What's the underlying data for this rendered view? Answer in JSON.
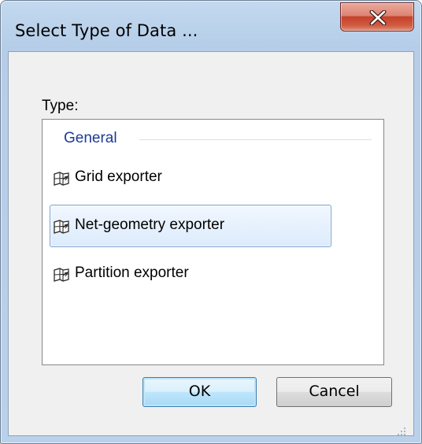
{
  "window": {
    "title": "Select Type of Data ..."
  },
  "colors": {
    "titlebar": "#c3d9ef",
    "close_button": "#c6412d",
    "group_header": "#1e3a96",
    "selection_border": "#7da2ce"
  },
  "type_label": "Type:",
  "list": {
    "group_header": "General",
    "items": [
      {
        "label": "Grid exporter",
        "icon": "exporter-icon",
        "selected": false
      },
      {
        "label": "Net-geometry exporter",
        "icon": "exporter-icon",
        "selected": true
      },
      {
        "label": "Partition exporter",
        "icon": "exporter-icon",
        "selected": false
      }
    ]
  },
  "buttons": {
    "ok": "OK",
    "cancel": "Cancel"
  }
}
